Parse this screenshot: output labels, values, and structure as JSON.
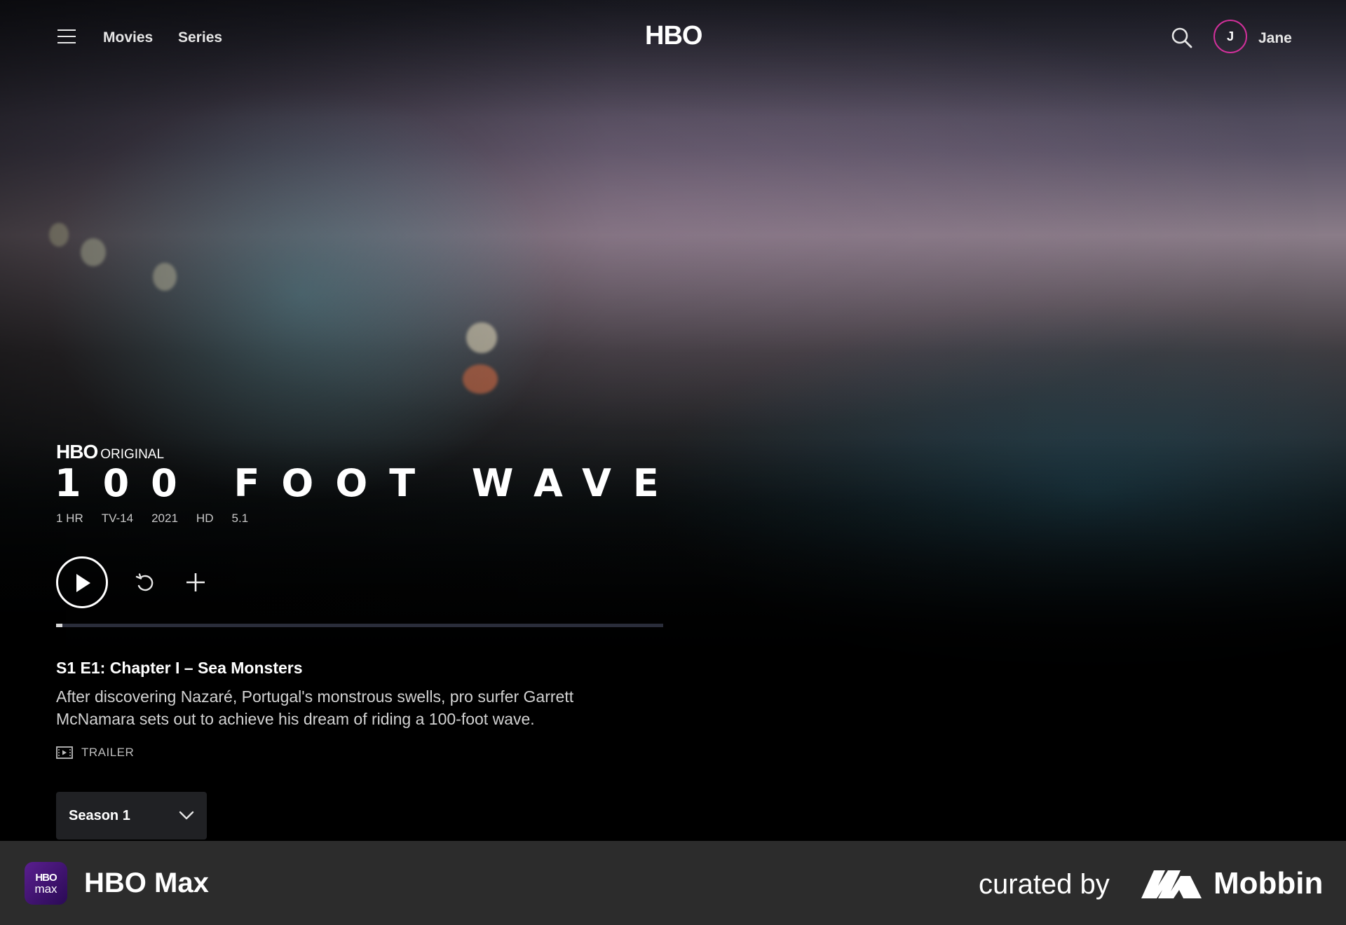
{
  "nav": {
    "menu_icon": "hamburger-menu-icon",
    "links": [
      "Movies",
      "Series"
    ],
    "brand": "HBO",
    "search_icon": "search-icon",
    "user": {
      "initial": "J",
      "name": "Jane"
    }
  },
  "show": {
    "badge_brand": "HBO",
    "badge_text": "ORIGINAL",
    "title": "100 FOOT WAVE",
    "meta": [
      "1 HR",
      "TV-14",
      "2021",
      "HD",
      "5.1"
    ],
    "progress": 0.01
  },
  "actions": {
    "play_icon": "play-icon",
    "restart_icon": "restart-icon",
    "add_icon": "plus-icon"
  },
  "episode": {
    "title": "S1 E1: Chapter I – Sea Monsters",
    "description": "After discovering Nazaré, Portugal's monstrous swells, pro surfer Garrett McNamara sets out to achieve his dream of riding a 100-foot wave.",
    "trailer_label": "TRAILER",
    "trailer_icon": "trailer-icon"
  },
  "season_select": {
    "selected": "Season 1",
    "icon": "chevron-down-icon"
  },
  "footer": {
    "app_icon_line1": "HBO",
    "app_icon_line2": "max",
    "app_name": "HBO Max",
    "curated_by": "curated by",
    "mobbin": "Mobbin"
  },
  "colors": {
    "accent_avatar": "#d0309a",
    "footer_bg": "#2c2c2c"
  }
}
